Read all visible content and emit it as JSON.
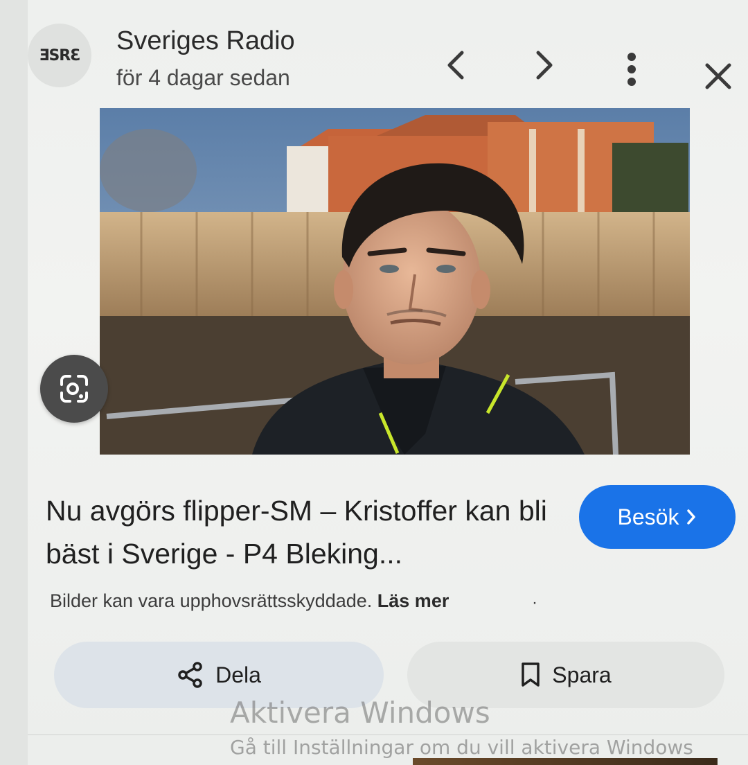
{
  "header": {
    "logo_text": "ƎSRƐ",
    "source_name": "Sveriges Radio",
    "timestamp": "för 4 dagar sedan",
    "icons": {
      "prev": "chevron-left-icon",
      "next": "chevron-right-icon",
      "more": "more-vert-icon",
      "close": "close-icon"
    }
  },
  "result": {
    "title": "Nu avgörs flipper-SM – Kristoffer kan bli bäst i Sverige - P4 Bleking...",
    "visit_label": "Besök",
    "copyright_text": "Bilder kan vara upphovsrättsskyddade.",
    "learn_more": "Läs mer",
    "separator": "·"
  },
  "actions": {
    "share_label": "Dela",
    "save_label": "Spara"
  },
  "watermark": {
    "title": "Aktivera Windows",
    "subtitle": "Gå till Inställningar om du vill aktivera Windows"
  },
  "colors": {
    "accent": "#1a73e8",
    "share_bg": "#dde3e9",
    "lens_bg": "#4b4b4b"
  }
}
